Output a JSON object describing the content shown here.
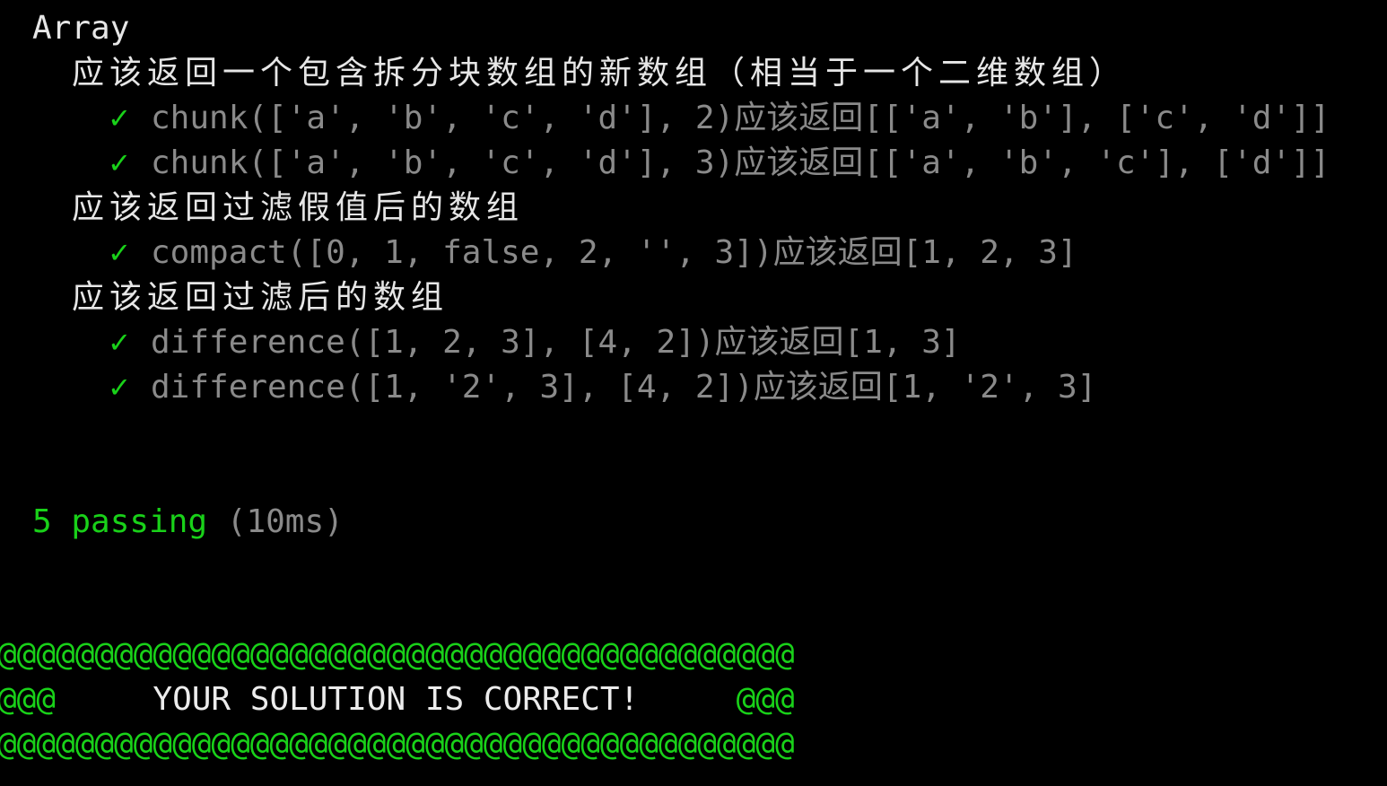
{
  "colors": {
    "background": "#000000",
    "pass_green": "#19d119",
    "title_text": "#e6e6e6",
    "test_text": "#8a8a8a"
  },
  "icons": {
    "check": "check-icon"
  },
  "suite": {
    "title": "Array",
    "groups": [
      {
        "title": "应该返回一个包含拆分块数组的新数组（相当于一个二维数组）",
        "tests": [
          {
            "check": "✓",
            "text": "chunk(['a', 'b', 'c', 'd'], 2)应该返回[['a', 'b'], ['c', 'd']]"
          },
          {
            "check": "✓",
            "text": "chunk(['a', 'b', 'c', 'd'], 3)应该返回[['a', 'b', 'c'], ['d']]"
          }
        ]
      },
      {
        "title": "应该返回过滤假值后的数组",
        "tests": [
          {
            "check": "✓",
            "text": "compact([0, 1, false, 2, '', 3])应该返回[1, 2, 3]"
          }
        ]
      },
      {
        "title": "应该返回过滤后的数组",
        "tests": [
          {
            "check": "✓",
            "text": "difference([1, 2, 3], [4, 2])应该返回[1, 3]"
          },
          {
            "check": "✓",
            "text": "difference([1, '2', 3], [4, 2])应该返回[1, '2', 3]"
          }
        ]
      }
    ]
  },
  "summary": {
    "passing": "5 passing",
    "duration": "(10ms)"
  },
  "banner": {
    "top": "@@@@@@@@@@@@@@@@@@@@@@@@@@@@@@@@@@@@@@@@@",
    "left": "@@@",
    "message": "     YOUR SOLUTION IS CORRECT!     ",
    "right": "@@@",
    "bottom": "@@@@@@@@@@@@@@@@@@@@@@@@@@@@@@@@@@@@@@@@@"
  }
}
